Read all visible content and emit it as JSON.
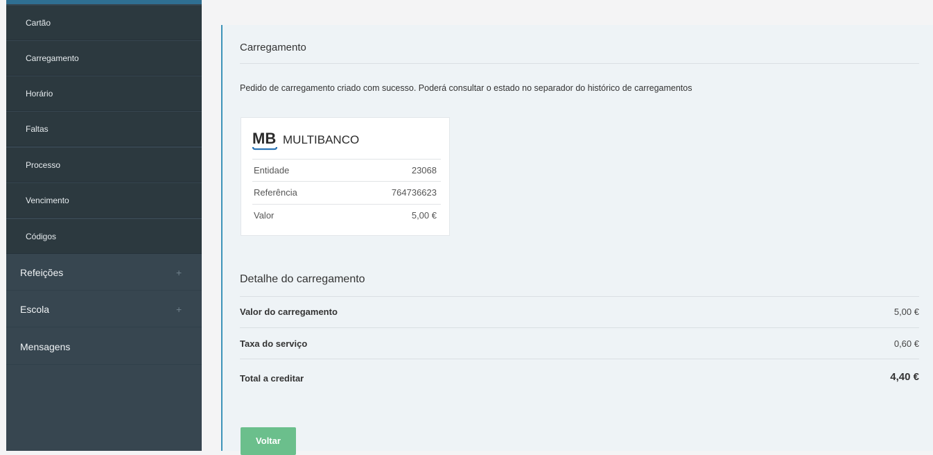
{
  "sidebar": {
    "sub_items": [
      {
        "label": "Cartão"
      },
      {
        "label": "Carregamento"
      },
      {
        "label": "Horário"
      },
      {
        "label": "Faltas"
      },
      {
        "label": "Processo"
      },
      {
        "label": "Vencimento"
      },
      {
        "label": "Códigos"
      }
    ],
    "main_items": [
      {
        "label": "Refeições",
        "expand": "+"
      },
      {
        "label": "Escola",
        "expand": "+"
      },
      {
        "label": "Mensagens"
      }
    ]
  },
  "panel": {
    "title": "Carregamento",
    "success_message": "Pedido de carregamento criado com sucesso. Poderá consultar o estado no separador do histórico de carregamentos"
  },
  "multibanco": {
    "logo_text": "MULTIBANCO",
    "logo_mark": "MB",
    "rows": [
      {
        "label": "Entidade",
        "value": "23068"
      },
      {
        "label": "Referência",
        "value": "764736623"
      },
      {
        "label": "Valor",
        "value": "5,00 €"
      }
    ]
  },
  "detail": {
    "title": "Detalhe do carregamento",
    "rows": [
      {
        "label": "Valor do carregamento",
        "value": "5,00 €"
      },
      {
        "label": "Taxa do serviço",
        "value": "0,60 €"
      },
      {
        "label": "Total a creditar",
        "value": "4,40 €"
      }
    ]
  },
  "actions": {
    "back_label": "Voltar"
  },
  "colors": {
    "sidebar_bg": "#374650",
    "sidebar_sub_bg": "#2c393f",
    "accent": "#3c93b8",
    "button_green": "#6bbf8c",
    "panel_bg": "#eef3f6"
  }
}
